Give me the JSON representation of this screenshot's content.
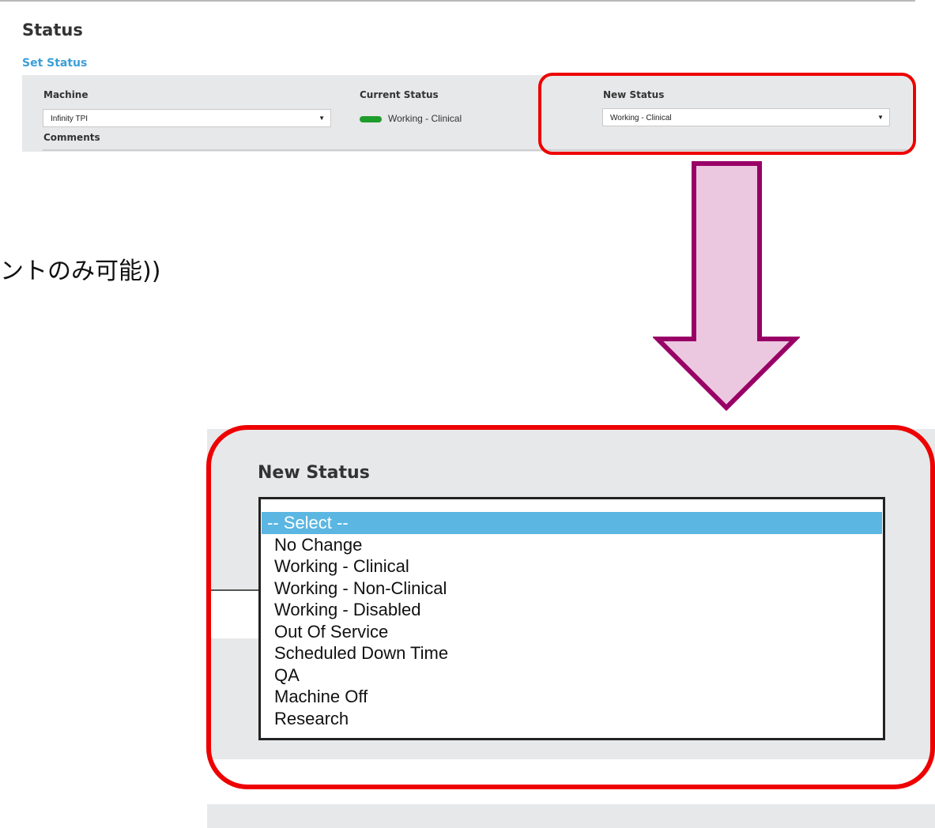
{
  "page": {
    "title": "Status",
    "section_link": "Set Status"
  },
  "form": {
    "machine_label": "Machine",
    "machine_value": "Infinity TPI",
    "current_status_label": "Current Status",
    "current_status_value": "Working - Clinical",
    "current_status_color": "#1f9d2c",
    "new_status_label": "New Status",
    "new_status_value": "Working - Clinical",
    "comments_label": "Comments"
  },
  "annotation": {
    "japanese_text": "ントのみ可能))",
    "highlight_color": "#ee0000",
    "arrow_fill": "#ecc8e0",
    "arrow_stroke": "#990066"
  },
  "zoom": {
    "label": "New Status",
    "options": [
      "-- Select --",
      "No Change",
      "Working - Clinical",
      "Working - Non-Clinical",
      "Working - Disabled",
      "Out Of Service",
      "Scheduled Down Time",
      "QA",
      "Machine Off",
      "Research"
    ],
    "selected_index": 0,
    "selected_color": "#5bb6e2"
  }
}
